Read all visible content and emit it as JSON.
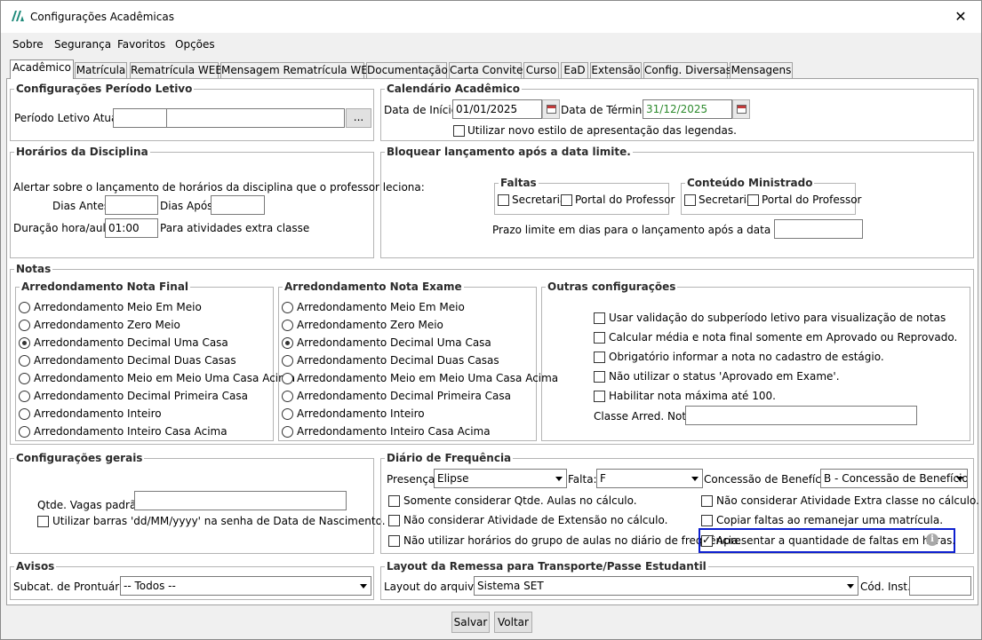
{
  "window": {
    "title": "Configurações Acadêmicas",
    "close_glyph": "✕"
  },
  "menu": [
    "Sobre",
    "Segurança",
    "Favoritos",
    "Opções"
  ],
  "tabs": [
    "Acadêmico",
    "Matrícula",
    "Rematrícula WEB",
    "Mensagem Rematrícula WEB",
    "Documentação",
    "Carta Convite",
    "Curso",
    "EaD",
    "Extensão",
    "Config. Diversas",
    "Mensagens"
  ],
  "periodo": {
    "legend": "Configurações Período Letivo",
    "label": "Período Letivo Atual:",
    "browse": "..."
  },
  "calendario": {
    "legend": "Calendário Acadêmico",
    "inicio_label": "Data de Início:",
    "inicio_value": "01/01/2025",
    "termino_label": "Data de Término:",
    "termino_value": "31/12/2025",
    "termino_color": "#2e8b2e",
    "legend_checkbox": "Utilizar novo estilo de apresentação das legendas."
  },
  "horarios": {
    "legend": "Horários da Disciplina",
    "alert": "Alertar sobre o lançamento de horários da disciplina que o professor leciona:",
    "dias_antes": "Dias Antes:",
    "dias_apos": "Dias Após:",
    "duracao_label": "Duração hora/aula:",
    "duracao_value": "01:00",
    "extra": "Para atividades extra classe"
  },
  "bloquear": {
    "legend": "Bloquear lançamento após a data limite.",
    "faltas": "Faltas",
    "conteudo": "Conteúdo Ministrado",
    "secretaria": "Secretaria",
    "portal": "Portal do Professor",
    "prazo": "Prazo limite em dias para o lançamento após a data da aula:"
  },
  "notas": {
    "legend": "Notas",
    "final_legend": "Arredondamento Nota Final",
    "exame_legend": "Arredondamento Nota Exame",
    "options": [
      "Arredondamento Meio Em Meio",
      "Arredondamento Zero Meio",
      "Arredondamento Decimal Uma Casa",
      "Arredondamento Decimal Duas Casas",
      "Arredondamento Meio em Meio Uma Casa Acima",
      "Arredondamento Decimal Primeira Casa",
      "Arredondamento Inteiro",
      "Arredondamento Inteiro Casa Acima"
    ],
    "selected_index": 2,
    "outras_legend": "Outras configurações",
    "outras": [
      "Usar validação do subperíodo letivo para visualização de notas",
      "Calcular média e nota final somente em Aprovado ou Reprovado.",
      "Obrigatório informar a nota no cadastro de estágio.",
      "Não utilizar o status 'Aprovado em Exame'.",
      "Habilitar nota máxima até 100."
    ],
    "classe_arred": "Classe Arred. Nota:"
  },
  "gerais": {
    "legend": "Configurações gerais",
    "vagas": "Qtde. Vagas padrão:",
    "barras": "Utilizar barras 'dd/MM/yyyy' na senha de Data de Nascimento."
  },
  "diario": {
    "legend": "Diário de Frequência",
    "presenca_label": "Presença:",
    "presenca_value": "Elipse",
    "falta_label": "Falta:",
    "falta_value": "F",
    "beneficio_label": "Concessão de Benefício:",
    "beneficio_value": "B - Concessão de Benefício",
    "left": [
      "Somente considerar Qtde. Aulas no cálculo.",
      "Não considerar Atividade de Extensão no cálculo.",
      "Não utilizar horários do grupo de aulas no diário de frequência."
    ],
    "right": [
      "Não considerar Atividade Extra classe no cálculo.",
      "Copiar faltas ao remanejar uma matrícula.",
      "Apresentar a quantidade de faltas em horas."
    ],
    "info_glyph": "i"
  },
  "avisos": {
    "legend": "Avisos",
    "label": "Subcat. de Prontuário:",
    "value": "-- Todos --"
  },
  "layout": {
    "legend": "Layout da Remessa para Transporte/Passe Estudantil",
    "label": "Layout do arquivo:",
    "value": "Sistema SET",
    "cod": "Cód. Inst.:"
  },
  "footer": {
    "save": "Salvar",
    "back": "Voltar"
  }
}
